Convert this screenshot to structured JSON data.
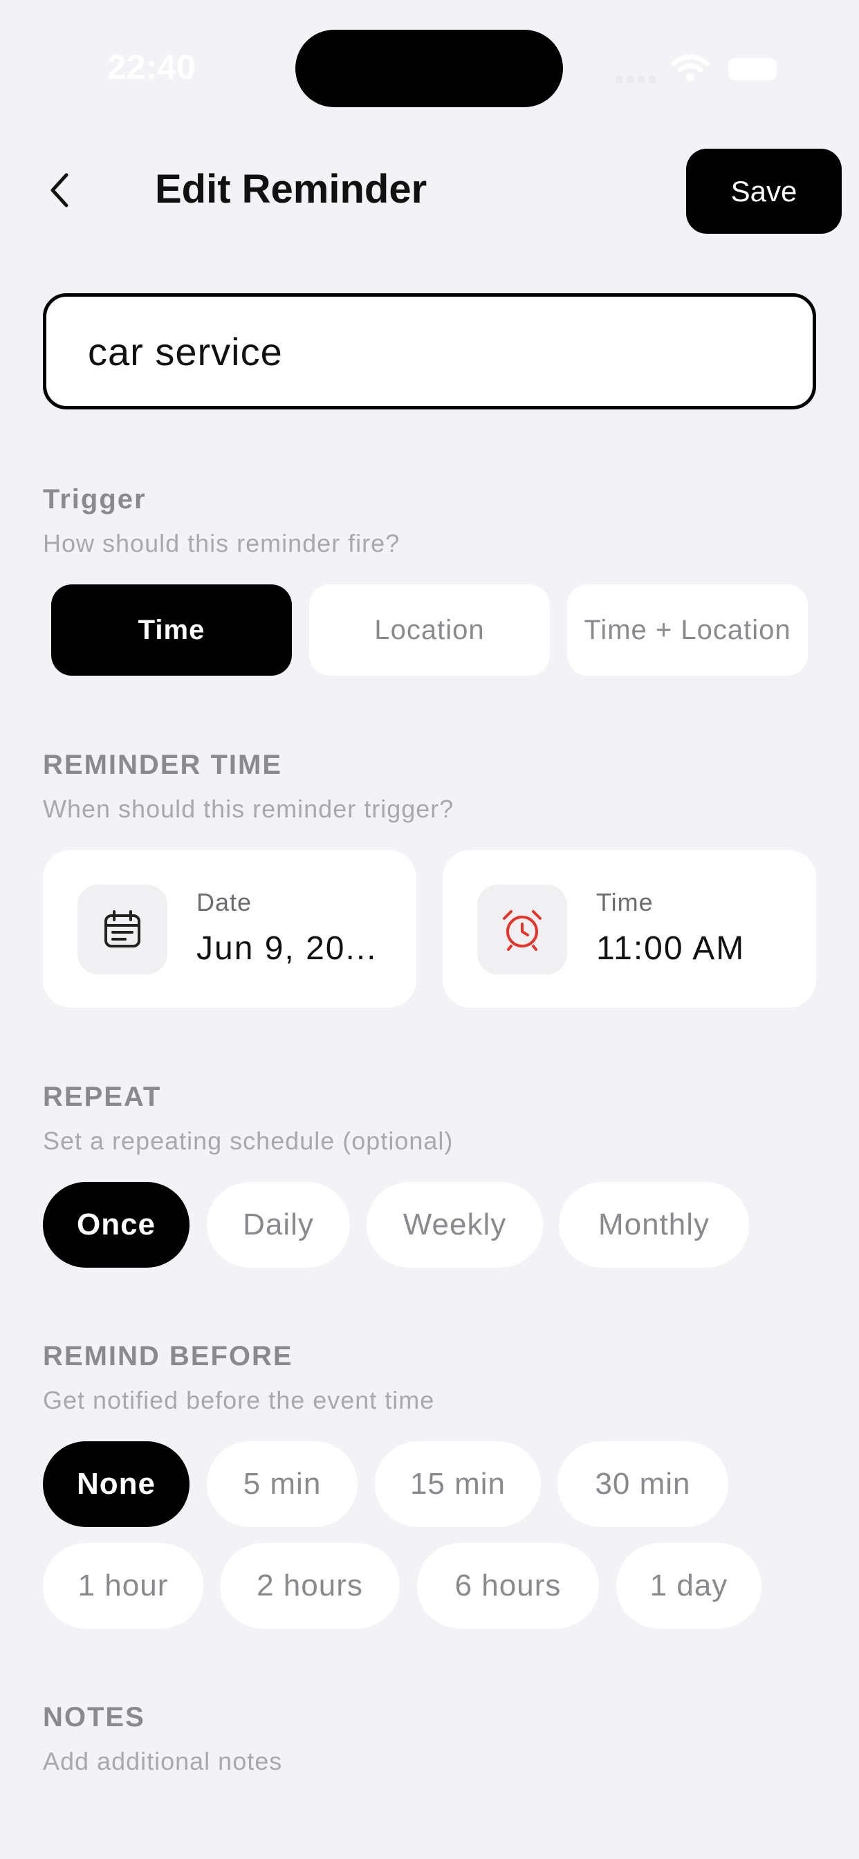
{
  "status_bar": {
    "time": "22:40"
  },
  "header": {
    "title": "Edit Reminder",
    "save_label": "Save"
  },
  "reminder": {
    "name": "car service"
  },
  "trigger": {
    "title": "Trigger",
    "subtitle": "How should this reminder fire?",
    "options": [
      "Time",
      "Location",
      "Time + Location"
    ],
    "selected": "Time"
  },
  "reminder_time": {
    "title": "REMINDER TIME",
    "subtitle": "When should this reminder trigger?",
    "date_label": "Date",
    "date_value": "Jun 9, 20...",
    "time_label": "Time",
    "time_value": "11:00 AM",
    "accent": "#e5342a"
  },
  "repeat": {
    "title": "REPEAT",
    "subtitle": "Set a repeating schedule (optional)",
    "options": [
      "Once",
      "Daily",
      "Weekly",
      "Monthly"
    ],
    "selected": "Once"
  },
  "remind_before": {
    "title": "REMIND BEFORE",
    "subtitle": "Get notified before the event time",
    "options": [
      "None",
      "5 min",
      "15 min",
      "30 min",
      "1 hour",
      "2 hours",
      "6 hours",
      "1 day"
    ],
    "selected": "None"
  },
  "notes": {
    "title": "NOTES",
    "subtitle": "Add additional notes"
  }
}
